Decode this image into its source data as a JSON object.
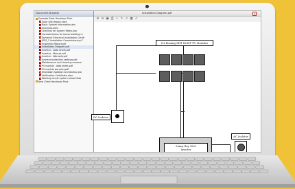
{
  "window": {
    "tree_title": "Document Browser",
    "document_tab": "Installation Diagram.pdf"
  },
  "tree": {
    "items": [
      {
        "label": "Example Solar Handover Pack",
        "icon": "folder-icon",
        "indent": 0
      },
      {
        "label": "Solar Site Report.xlsm",
        "icon": "document-icon",
        "indent": 1
      },
      {
        "label": "Basic System Information.doc",
        "icon": "document-icon",
        "indent": 1
      },
      {
        "label": "Checklist.xlsm",
        "icon": "document-icon",
        "indent": 1
      },
      {
        "label": "Checklist for system fitters.doc",
        "icon": "document-icon",
        "indent": 1
      },
      {
        "label": "Considerations for house building m",
        "icon": "document-icon",
        "indent": 1
      },
      {
        "label": "Domestic Electrical Installation Certifi",
        "icon": "document-icon",
        "indent": 1
      },
      {
        "label": "MCS_1 Installation Commissioning C",
        "icon": "document-icon",
        "indent": 1
      },
      {
        "label": "Inspection Report.pdf",
        "icon": "document-icon",
        "indent": 1
      },
      {
        "label": "Installation Diagram.pdf",
        "icon": "document-icon",
        "indent": 1,
        "selected": true
      },
      {
        "label": "Inverter - Data Sheet.pdf",
        "icon": "document-icon",
        "indent": 1
      },
      {
        "label": "Inverter - Manual.pdf",
        "icon": "document-icon",
        "indent": 1
      },
      {
        "label": "Inverter - Warranty.pdf",
        "icon": "document-icon",
        "indent": 1
      },
      {
        "label": "Inverter protection settings.pdf",
        "icon": "document-icon",
        "indent": 1
      },
      {
        "label": "Maintenance and cleaning recomm",
        "icon": "document-icon",
        "indent": 1
      },
      {
        "label": "PV module - data sheet.pdf",
        "icon": "document-icon",
        "indent": 1
      },
      {
        "label": "PV module warranty.pdf",
        "icon": "document-icon",
        "indent": 1
      },
      {
        "label": "Shutdown isolation and startup pro",
        "icon": "document-icon",
        "indent": 1
      },
      {
        "label": "Verification Certificate.xlsm",
        "icon": "document-icon",
        "indent": 1
      },
      {
        "label": "Working circuit system photo Data",
        "icon": "document-icon",
        "indent": 1
      },
      {
        "label": "New Client Handover Pack",
        "icon": "folder-icon",
        "indent": 0
      }
    ]
  },
  "toolbar": {
    "icons": [
      "zoom-in-icon",
      "zoom-out-icon",
      "fit-page-icon",
      "print-icon",
      "search-icon",
      "pen-icon",
      "arrow-icon",
      "stamp-icon",
      "warning-icon"
    ]
  },
  "diagram": {
    "modules_label": "8 x Bosang SHT 6260F PV Modules",
    "dc_isolator_label": "DC Isolator",
    "ac_isolator_label": "AC Isolator",
    "inverter_line1": "Sunny Boy 3000",
    "inverter_line2": "Inverter"
  },
  "colors": {
    "background": "#f0c238",
    "module": "#5d5d5d",
    "selection": "#dbe6f7"
  }
}
